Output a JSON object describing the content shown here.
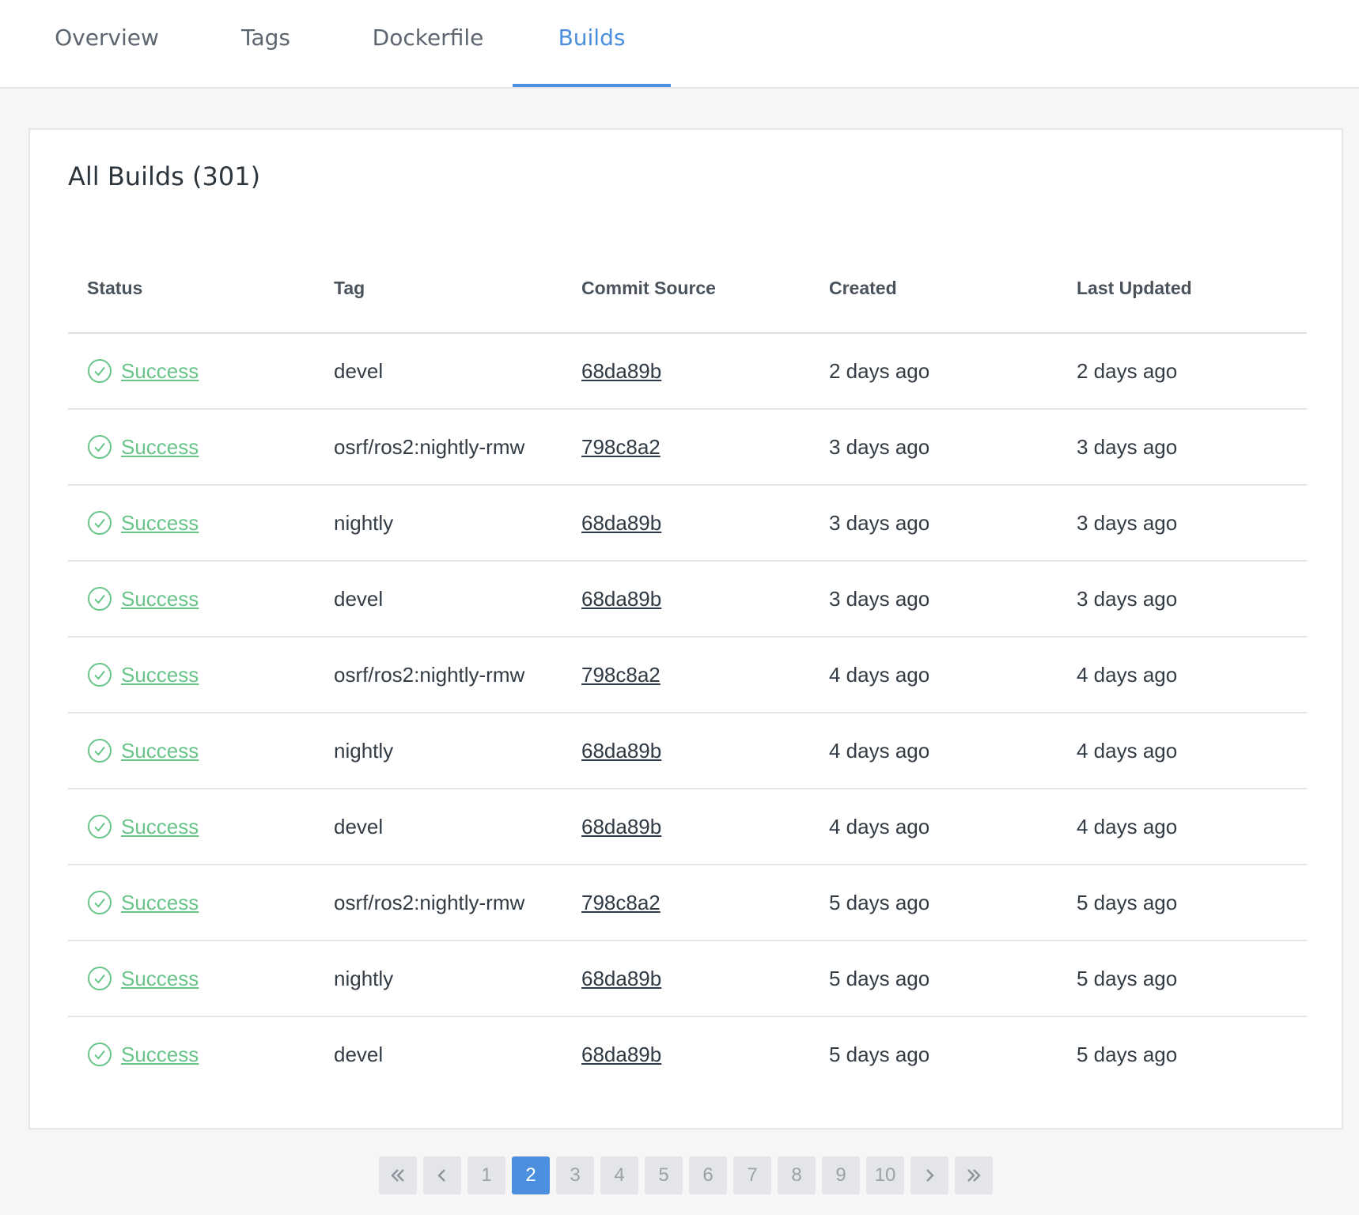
{
  "tabs": [
    {
      "label": "Overview",
      "active": false
    },
    {
      "label": "Tags",
      "active": false
    },
    {
      "label": "Dockerfile",
      "active": false
    },
    {
      "label": "Builds",
      "active": true
    }
  ],
  "builds": {
    "title": "All Builds (301)",
    "columns": [
      "Status",
      "Tag",
      "Commit Source",
      "Created",
      "Last Updated"
    ],
    "rows": [
      {
        "status": "Success",
        "tag": "devel",
        "commit": "68da89b",
        "created": "2 days ago",
        "updated": "2 days ago"
      },
      {
        "status": "Success",
        "tag": "osrf/ros2:nightly-rmw",
        "commit": "798c8a2",
        "created": "3 days ago",
        "updated": "3 days ago"
      },
      {
        "status": "Success",
        "tag": "nightly",
        "commit": "68da89b",
        "created": "3 days ago",
        "updated": "3 days ago"
      },
      {
        "status": "Success",
        "tag": "devel",
        "commit": "68da89b",
        "created": "3 days ago",
        "updated": "3 days ago"
      },
      {
        "status": "Success",
        "tag": "osrf/ros2:nightly-rmw",
        "commit": "798c8a2",
        "created": "4 days ago",
        "updated": "4 days ago"
      },
      {
        "status": "Success",
        "tag": "nightly",
        "commit": "68da89b",
        "created": "4 days ago",
        "updated": "4 days ago"
      },
      {
        "status": "Success",
        "tag": "devel",
        "commit": "68da89b",
        "created": "4 days ago",
        "updated": "4 days ago"
      },
      {
        "status": "Success",
        "tag": "osrf/ros2:nightly-rmw",
        "commit": "798c8a2",
        "created": "5 days ago",
        "updated": "5 days ago"
      },
      {
        "status": "Success",
        "tag": "nightly",
        "commit": "68da89b",
        "created": "5 days ago",
        "updated": "5 days ago"
      },
      {
        "status": "Success",
        "tag": "devel",
        "commit": "68da89b",
        "created": "5 days ago",
        "updated": "5 days ago"
      }
    ]
  },
  "pagination": {
    "pages": [
      "1",
      "2",
      "3",
      "4",
      "5",
      "6",
      "7",
      "8",
      "9",
      "10"
    ],
    "current": "2"
  },
  "colors": {
    "accent": "#4b8fde",
    "success": "#69c48a"
  }
}
